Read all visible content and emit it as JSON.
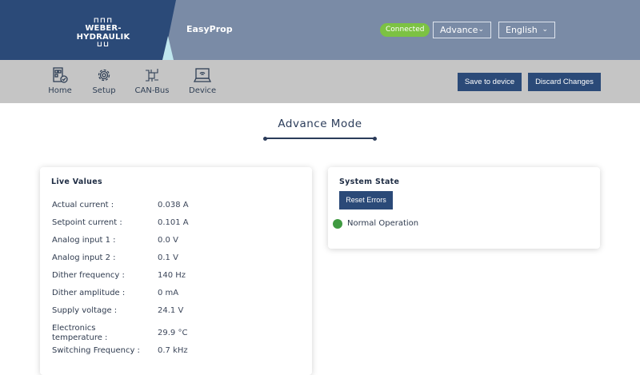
{
  "header": {
    "logo_text": "WEBER-HYDRAULIK",
    "app_name": "EasyProp",
    "connection_status": "Connected",
    "mode_select": "Advance",
    "language_select": "English"
  },
  "nav": {
    "items": [
      {
        "label": "Home",
        "icon": "home-icon"
      },
      {
        "label": "Setup",
        "icon": "gear-icon"
      },
      {
        "label": "CAN-Bus",
        "icon": "circuit-icon"
      },
      {
        "label": "Device",
        "icon": "laptop-icon"
      }
    ],
    "save_label": "Save to device",
    "discard_label": "Discard Changes"
  },
  "page": {
    "title": "Advance Mode"
  },
  "live_values": {
    "title": "Live Values",
    "rows": [
      {
        "label": "Actual current :",
        "value": "0.038 A"
      },
      {
        "label": "Setpoint current :",
        "value": "0.101 A"
      },
      {
        "label": "Analog input 1 :",
        "value": "0.0 V"
      },
      {
        "label": "Analog input 2 :",
        "value": "0.1 V"
      },
      {
        "label": "Dither frequency :",
        "value": "140 Hz"
      },
      {
        "label": "Dither amplitude :",
        "value": "0 mA"
      },
      {
        "label": "Supply voltage :",
        "value": "24.1 V"
      },
      {
        "label": "Electronics temperature :",
        "value": "29.9 °C"
      },
      {
        "label": "Switching Frequency :",
        "value": "0.7 kHz"
      }
    ]
  },
  "system_state": {
    "title": "System State",
    "reset_label": "Reset Errors",
    "status": "Normal Operation",
    "status_color": "#3f9a41"
  }
}
